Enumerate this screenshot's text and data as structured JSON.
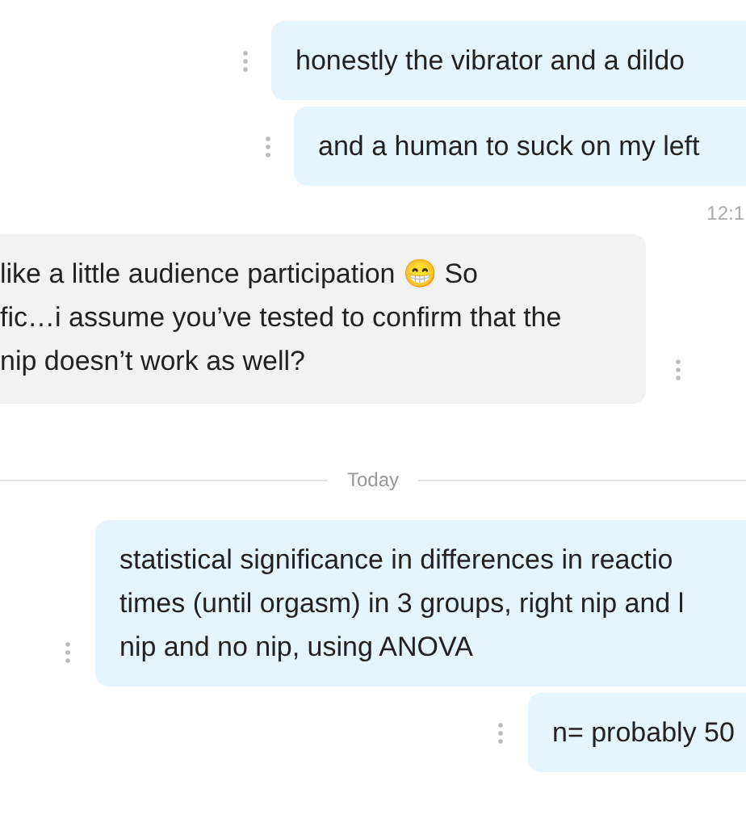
{
  "messages": [
    {
      "kind": "outgoing",
      "text": "honestly the vibrator and a dildo"
    },
    {
      "kind": "outgoing",
      "text": "and a human to suck on my left"
    },
    {
      "kind": "time",
      "text": "12:1"
    },
    {
      "kind": "incoming",
      "text": "like a little audience participation 😁 So\nfic…i assume you’ve tested to confirm that the\nnip doesn’t work as well?"
    },
    {
      "kind": "divider",
      "text": "Today"
    },
    {
      "kind": "outgoing",
      "text": "statistical significance in differences in reactio\ntimes (until orgasm) in 3 groups, right nip and l\nnip and no nip, using ANOVA"
    },
    {
      "kind": "outgoing",
      "text": "n= probably 50"
    }
  ]
}
